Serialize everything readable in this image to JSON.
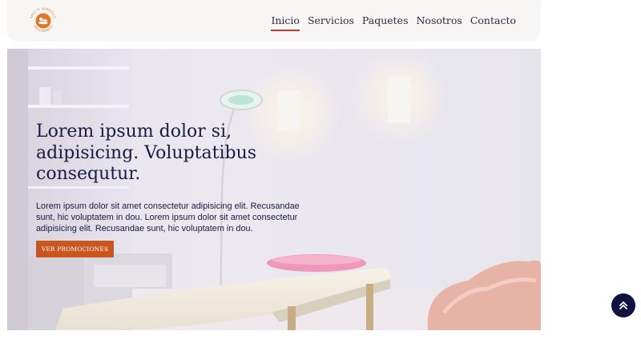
{
  "header": {
    "logo": {
      "icon": "spa-logo-icon",
      "arc_text_top": "AMETTE GABRIELLE",
      "arc_text_bottom": "MASOTERAPIA",
      "color": "#e0782a"
    },
    "nav": [
      {
        "label": "Inicio",
        "active": true
      },
      {
        "label": "Servicios",
        "active": false
      },
      {
        "label": "Paquetes",
        "active": false
      },
      {
        "label": "Nosotros",
        "active": false
      },
      {
        "label": "Contacto",
        "active": false
      }
    ],
    "active_underline_color": "#c0392b"
  },
  "hero": {
    "title": "Lorem ipsum dolor si, adipisicing. Voluptatibus consequtur.",
    "text": "Lorem ipsum dolor sit amet consectetur adipisicing elit. Recusandae sunt, hic voluptatem in dou. Lorem ipsum dolor sit amet consectetur adipisicing elit. Recusandae sunt, hic voluptatem in dou.",
    "button_label": "VER PROMOCIONES",
    "button_color": "#c9561f",
    "image": "massage-room-photo"
  },
  "scroll_top": {
    "icon": "double-chevron-up-icon",
    "color": "#111142"
  }
}
